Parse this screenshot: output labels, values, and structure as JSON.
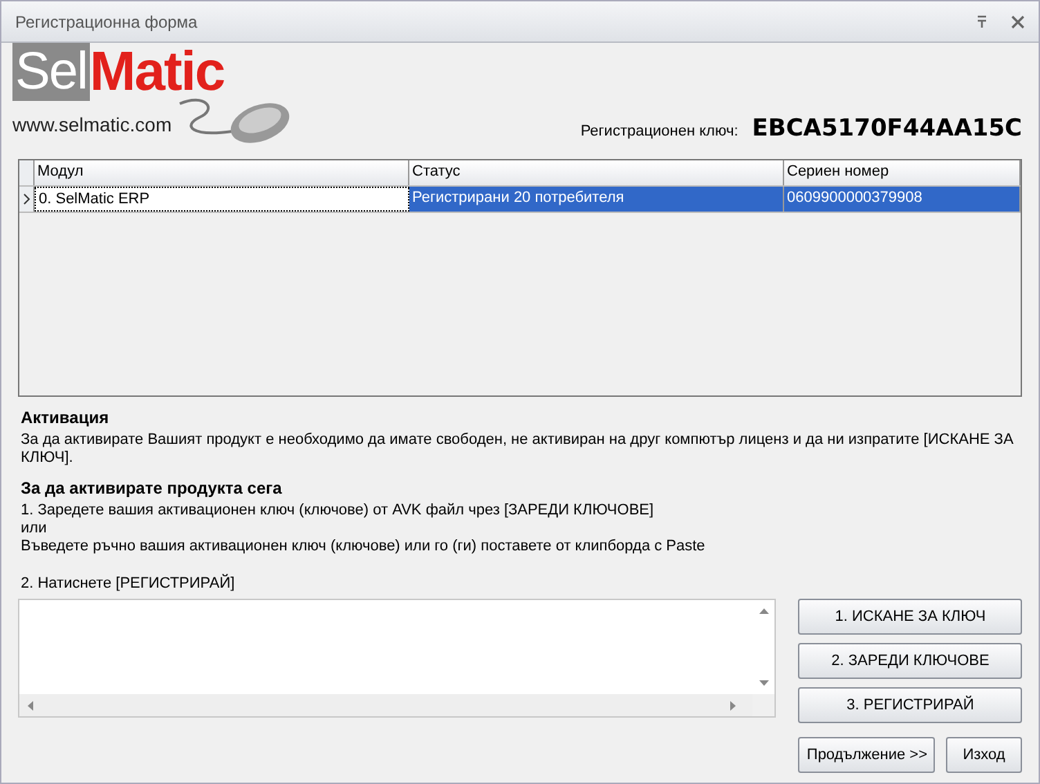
{
  "window": {
    "title": "Регистрационна форма"
  },
  "logo": {
    "part_1": "Sel",
    "part_2": "Matic",
    "url": "www.selmatic.com"
  },
  "registration": {
    "label": "Регистрационен ключ:",
    "key": "EBCA5170F44AA15C"
  },
  "table": {
    "columns": [
      "Модул",
      "Статус",
      "Сериен номер"
    ],
    "rows": [
      {
        "selected": true,
        "cells": [
          "0.  SelMatic ERP",
          "Регистрирани 20 потребителя",
          "0609900000379908"
        ]
      }
    ]
  },
  "activation": {
    "heading": "Активация",
    "text": "За да активирате Вашият продукт е необходимо да имате свободен, не активиран на друг компютър лиценз и да ни изпратите [ИСКАНЕ ЗА КЛЮЧ]."
  },
  "instructions": {
    "heading": "За да активирате продукта сега",
    "lines": [
      "1. Заредете вашия активационен ключ (ключове) от AVK файл чрез [ЗАРЕДИ КЛЮЧОВЕ]",
      "или",
      "Въведете ръчно вашия активационен ключ (ключове) или го (ги) поставете от клипборда с Paste"
    ],
    "step_2": "2. Натиснете [РЕГИСТРИРАЙ]"
  },
  "action_buttons": [
    "1. ИСКАНЕ ЗА КЛЮЧ",
    "2. ЗАРЕДИ КЛЮЧОВЕ",
    "3. РЕГИСТРИРАЙ"
  ],
  "footer_buttons": [
    "Продължение >>",
    "Изход"
  ]
}
